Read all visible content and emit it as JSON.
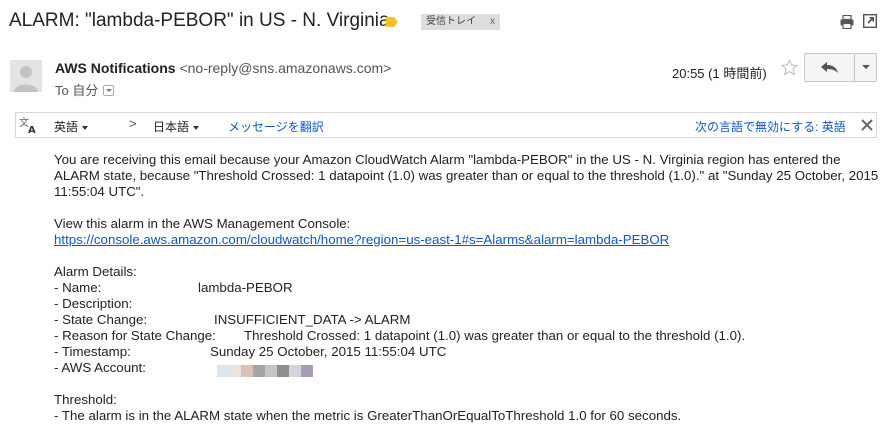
{
  "header": {
    "subject": "ALARM: \"lambda-PEBOR\" in US - N. Virginia",
    "label": "受信トレイ",
    "label_close": "x"
  },
  "message": {
    "sender_name": "AWS Notifications",
    "sender_email": "<no-reply@sns.amazonaws.com>",
    "to_line": "To 自分",
    "time": "20:55 (1 時間前)"
  },
  "translate_bar": {
    "source_language": "英語",
    "arrow": ">",
    "target_language": "日本語",
    "translate_link": "メッセージを翻訳",
    "disable_link": "次の言語で無効にする: 英語"
  },
  "body": {
    "intro": "You are receiving this email because your Amazon CloudWatch Alarm \"lambda-PEBOR\" in the US - N. Virginia region has entered the ALARM state, because \"Threshold Crossed: 1 datapoint (1.0) was greater than or equal to the threshold (1.0).\" at \"Sunday 25 October, 2015 11:55:04 UTC\".",
    "console_text": "View this alarm in the AWS Management Console:",
    "console_link": "https://console.aws.amazon.com/cloudwatch/home?region=us-east-1#s=Alarms&alarm=lambda-PEBOR",
    "details_heading": "Alarm Details:",
    "details": [
      {
        "label": "- Name:",
        "value": "lambda-PEBOR"
      },
      {
        "label": "- Description:",
        "value": ""
      },
      {
        "label": "- State Change:",
        "value": "INSUFFICIENT_DATA -> ALARM"
      },
      {
        "label": "- Reason for State Change:",
        "value": "Threshold Crossed: 1 datapoint (1.0) was greater than or equal to the threshold (1.0)."
      },
      {
        "label": "- Timestamp:",
        "value": "Sunday 25 October, 2015 11:55:04 UTC"
      },
      {
        "label": "- AWS Account:",
        "value": ""
      }
    ],
    "threshold_heading": "Threshold:",
    "threshold_text": "- The alarm is in the ALARM state when the metric is GreaterThanOrEqualToThreshold 1.0 for 60 seconds."
  },
  "colors": {
    "link": "#1155cc",
    "label_tag": "#f6c026",
    "label_chip": "#dddddd",
    "account_mask": [
      "#dce6ef",
      "#e9e4e0",
      "#d8c2b5",
      "#a8a4a6",
      "#c3c5cc",
      "#8f8f91",
      "#d6d3d8",
      "#a79bb8"
    ]
  },
  "icons": [
    "label-tag-icon",
    "print-icon",
    "new-window-icon",
    "avatar-icon",
    "star-icon",
    "reply-icon",
    "more-options-icon",
    "translate-icon",
    "close-icon"
  ]
}
